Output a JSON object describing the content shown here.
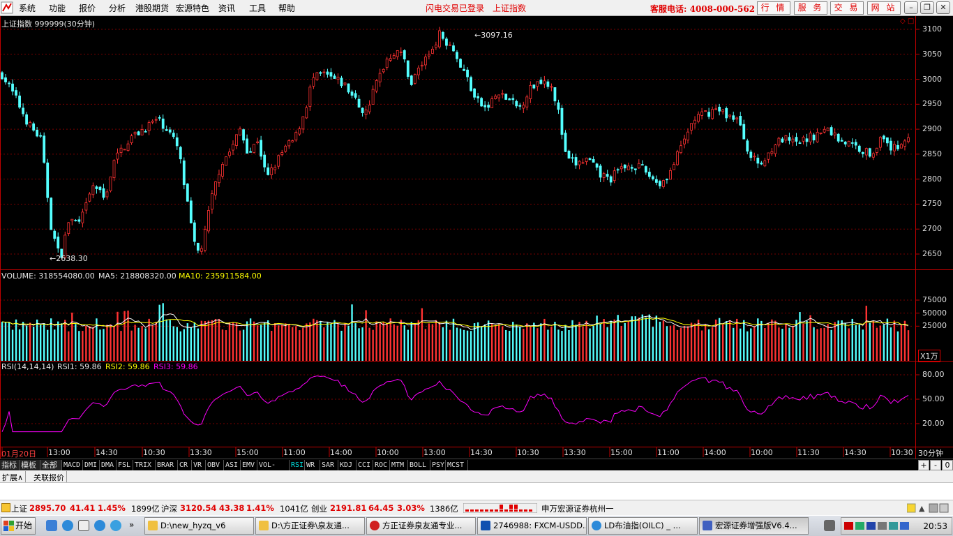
{
  "menu": {
    "items": [
      "系统",
      "功能",
      "报价",
      "分析",
      "港股期货",
      "宏源特色",
      "资讯",
      "工具",
      "帮助"
    ],
    "status1": "闪电交易已登录",
    "status2": "上证指数",
    "phone": "客服电话: 4008-000-562",
    "buttons": [
      "行 情",
      "服 务",
      "交 易",
      "网 站"
    ]
  },
  "price_panel": {
    "title": "上证指数 999999(30分钟)",
    "high_label": "3097.16",
    "low_label": "2638.30",
    "axis": [
      "3100",
      "3050",
      "3000",
      "2950",
      "2900",
      "2850",
      "2800",
      "2750",
      "2700",
      "2650"
    ]
  },
  "volume_panel": {
    "label_vol": "VOLUME: 318554080.00",
    "label_ma5": "MA5: 218808320.00",
    "label_ma10": "MA10: 235911584.00",
    "axis": [
      "75000",
      "50000",
      "25000"
    ],
    "unit": "X1万"
  },
  "rsi_panel": {
    "label_head": "RSI(14,14,14)",
    "label_r1": "RSI1: 59.86",
    "label_r2": "RSI2: 59.86",
    "label_r3": "RSI3: 59.86",
    "axis": [
      "80.00",
      "50.00",
      "20.00"
    ]
  },
  "time_axis": {
    "labels": [
      "01月20日",
      "13:00",
      "14:30",
      "10:30",
      "13:30",
      "15:00",
      "11:00",
      "14:00",
      "10:00",
      "13:00",
      "14:30",
      "10:30",
      "13:30",
      "15:00",
      "11:00",
      "14:00",
      "10:00",
      "11:30",
      "14:30",
      "10:30"
    ],
    "period": "30分钟"
  },
  "tabs": [
    "指标",
    "模板",
    "全部",
    "MACD",
    "DMI",
    "DMA",
    "FSL",
    "TRIX",
    "BRAR",
    "CR",
    "VR",
    "OBV",
    "ASI",
    "EMV",
    "VOL-TDX",
    "RSI",
    "WR",
    "SAR",
    "KDJ",
    "CCI",
    "ROC",
    "MTM",
    "BOLL",
    "PSY",
    "MCST"
  ],
  "tab_right": [
    "+",
    "-",
    "0"
  ],
  "ext_tabs": [
    "扩展∧",
    "关联报价"
  ],
  "ticker": {
    "sh_name": "上证",
    "sh_price": "2895.70",
    "sh_chg": "41.41",
    "sh_pct": "1.45%",
    "sh_amt": "1899亿",
    "hs_name": "沪深",
    "hs_price": "3120.54",
    "hs_chg": "43.38",
    "hs_pct": "1.41%",
    "hs_amt": "1041亿",
    "cy_name": "创业",
    "cy_price": "2191.81",
    "cy_chg": "64.45",
    "cy_pct": "3.03%",
    "cy_amt": "1386亿",
    "broker": "申万宏源证券杭州一"
  },
  "taskbar": {
    "start": "开始",
    "tasks": [
      "D:\\new_hyzq_v6",
      "D:\\方正证券\\泉友通...",
      "方正证券泉友通专业...",
      "2746988: FXCM-USDD...",
      "LD布油指(OILC) _ ...",
      "宏源证券增强版V6.4..."
    ],
    "clock": "20:53"
  },
  "colors": {
    "up": "#ff3232",
    "down": "#54ffff",
    "ma5": "#ffffff",
    "ma10": "#ffff00",
    "rsi": "#ff00ff",
    "grid": "#8a0000"
  }
}
